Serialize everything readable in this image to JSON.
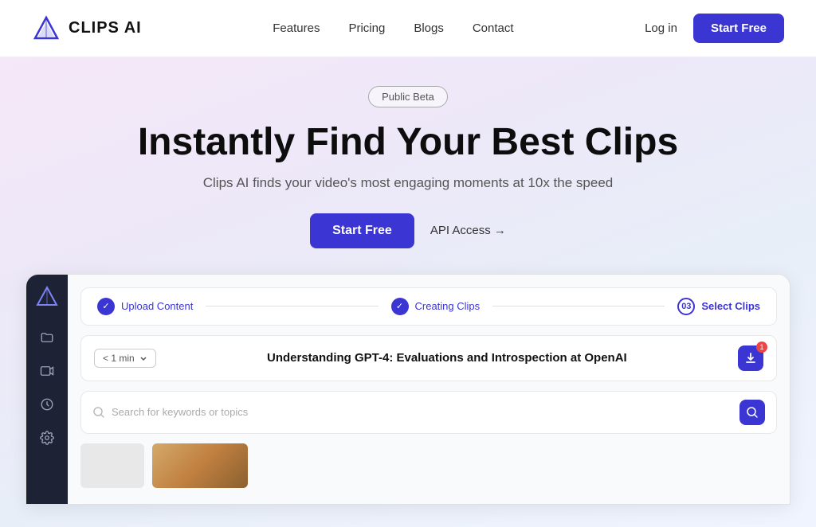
{
  "nav": {
    "logo_text": "CLIPS AI",
    "links": [
      {
        "label": "Features",
        "id": "features"
      },
      {
        "label": "Pricing",
        "id": "pricing"
      },
      {
        "label": "Blogs",
        "id": "blogs"
      },
      {
        "label": "Contact",
        "id": "contact"
      }
    ],
    "login_label": "Log in",
    "start_free_label": "Start Free"
  },
  "hero": {
    "badge": "Public Beta",
    "title": "Instantly Find Your Best Clips",
    "subtitle": "Clips AI finds your video's most engaging moments at 10x the speed",
    "cta_primary": "Start Free",
    "cta_secondary": "API Access →"
  },
  "app": {
    "steps": [
      {
        "label": "Upload Content",
        "status": "done"
      },
      {
        "label": "Creating Clips",
        "status": "done"
      },
      {
        "label": "Select Clips",
        "status": "active",
        "num": "03"
      }
    ],
    "video": {
      "duration": "< 1 min",
      "title": "Understanding GPT-4: Evaluations and Introspection at OpenAI",
      "badge_count": "1"
    },
    "search": {
      "placeholder": "Search for keywords or topics"
    }
  },
  "sidebar": {
    "icons": [
      "logo",
      "folder",
      "video",
      "clock",
      "settings"
    ]
  }
}
